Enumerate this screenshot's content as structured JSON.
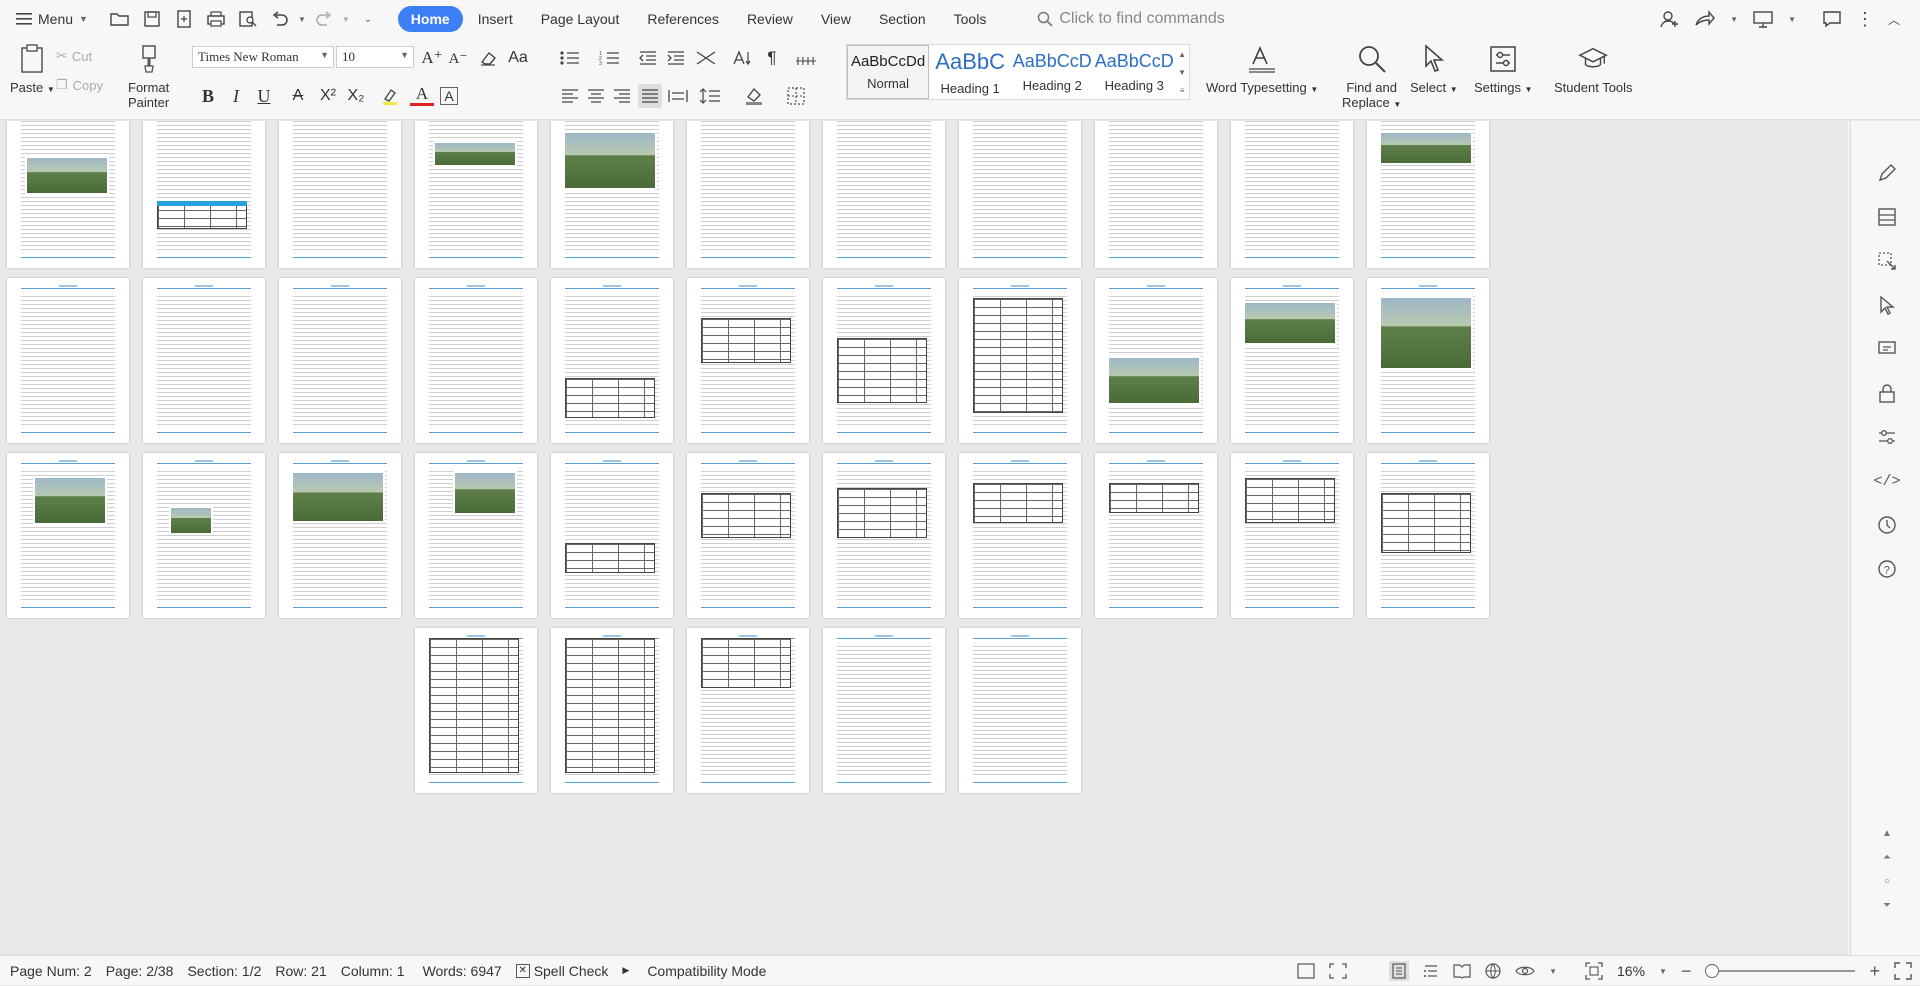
{
  "titlebar": {
    "menu_label": "Menu",
    "tabs": [
      {
        "label": "Home",
        "active": true
      },
      {
        "label": "Insert"
      },
      {
        "label": "Page Layout"
      },
      {
        "label": "References"
      },
      {
        "label": "Review"
      },
      {
        "label": "View"
      },
      {
        "label": "Section"
      },
      {
        "label": "Tools"
      }
    ],
    "search_placeholder": "Click to find commands",
    "accent_color": "#3d7ff5"
  },
  "ribbon": {
    "paste_label": "Paste",
    "cut_label": "Cut",
    "copy_label": "Copy",
    "format_painter_label_1": "Format",
    "format_painter_label_2": "Painter",
    "font_name": "Times New Roman",
    "font_size": "10",
    "styles": [
      {
        "preview": "AaBbCcDd",
        "name": "Normal",
        "color": "#222222"
      },
      {
        "preview": "AaBbC",
        "name": "Heading 1",
        "color": "#2e6fc5"
      },
      {
        "preview": "AaBbCcD",
        "name": "Heading 2",
        "color": "#2e6fc5"
      },
      {
        "preview": "AaBbCcD",
        "name": "Heading 3",
        "color": "#2e6fc5"
      }
    ],
    "word_typesetting_label": "Word Typesetting",
    "find_replace_label_1": "Find and",
    "find_replace_label_2": "Replace",
    "select_label": "Select",
    "settings_label": "Settings",
    "student_tools_label": "Student Tools"
  },
  "status": {
    "page_num": "Page Num: 2",
    "page": "Page: 2/38",
    "section": "Section: 1/2",
    "row": "Row: 21",
    "column": "Column: 1",
    "words": "Words: 6947",
    "spell_check": "Spell Check",
    "compat": "Compatibility Mode",
    "zoom": "16%"
  }
}
